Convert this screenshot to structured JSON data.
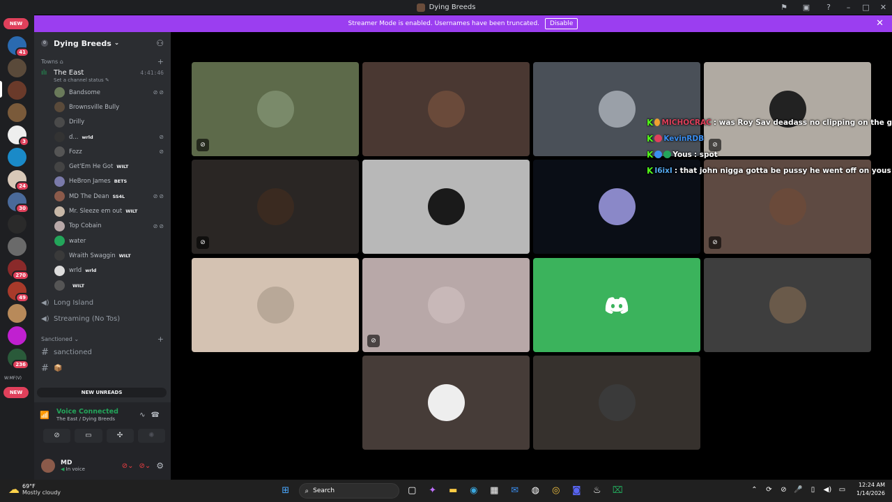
{
  "window": {
    "title": "Dying Breeds"
  },
  "banner": {
    "text": "Streamer Mode is enabled. Usernames have been truncated.",
    "button": "Disable"
  },
  "rail": {
    "badges": [
      "NEW",
      "41",
      "3",
      "24",
      "30",
      "270",
      "49",
      "236",
      "W:MF(V)",
      "NEW"
    ]
  },
  "server": {
    "name": "Dying Breeds"
  },
  "categories": {
    "towns": "Towns",
    "sanctioned": "Sanctioned"
  },
  "voice_channels": {
    "east": {
      "name": "The East",
      "timer": "4:41:46",
      "status": "Set a channel status"
    },
    "long_island": {
      "name": "Long Island"
    },
    "streaming": {
      "name": "Streaming (No Tos)"
    }
  },
  "members": [
    {
      "name": "Bandsome",
      "tag": "",
      "color": "#6a7a5a"
    },
    {
      "name": "Brownsville Bully",
      "tag": "",
      "color": "#5a4a3a"
    },
    {
      "name": "Drilly",
      "tag": "",
      "color": "#4a4a4a"
    },
    {
      "name": "d...",
      "tag": "wrld",
      "color": "#333333"
    },
    {
      "name": "Fozz",
      "tag": "",
      "color": "#555555"
    },
    {
      "name": "Get'Em He Got",
      "tag": "WILT",
      "color": "#444444"
    },
    {
      "name": "HeBron James",
      "tag": "BETS",
      "color": "#7a7aaa"
    },
    {
      "name": "MD The Dean",
      "tag": "SS4L",
      "color": "#8b5a4a"
    },
    {
      "name": "Mr. Sleeze em out",
      "tag": "WILT",
      "color": "#c8b8a8"
    },
    {
      "name": "Top Cobain",
      "tag": "",
      "color": "#b8a8a8"
    },
    {
      "name": "water",
      "tag": "",
      "color": "#23a55a"
    },
    {
      "name": "Wraith Swaggin",
      "tag": "WILT",
      "color": "#3a3a3a"
    },
    {
      "name": "wrld",
      "tag": "wrld",
      "color": "#dddddd"
    },
    {
      "name": "",
      "tag": "WILT",
      "color": "#555555"
    }
  ],
  "text_channels": {
    "sanctioned": "sanctioned",
    "box": "📦"
  },
  "new_unreads": "NEW UNREADS",
  "voice_panel": {
    "title": "Voice Connected",
    "subtitle": "The East / Dying Breeds"
  },
  "user": {
    "name": "MD",
    "status": "In voice"
  },
  "tiles": [
    {
      "bg": "#5d6a4a",
      "pfp": "#7a8a6a",
      "muted": true
    },
    {
      "bg": "#4a3832",
      "pfp": "#6a4a3a",
      "muted": false
    },
    {
      "bg": "#4a5058",
      "pfp": "#9aa0a8",
      "muted": false
    },
    {
      "bg": "#b0aaa2",
      "pfp": "#222222",
      "muted": true
    },
    {
      "bg": "#2a2624",
      "pfp": "#3a2a20",
      "muted": true
    },
    {
      "bg": "#b8b8b8",
      "pfp": "#1a1a1a",
      "muted": false
    },
    {
      "bg": "#0a0e16",
      "pfp": "#8a88c8",
      "muted": false
    },
    {
      "bg": "#5e4a42",
      "pfp": "#6a4a3a",
      "muted": true
    },
    {
      "bg": "#d4c2b2",
      "pfp": "#b8a898",
      "muted": false
    },
    {
      "bg": "#b8a8a8",
      "pfp": "#c8b8b8",
      "muted": true
    },
    {
      "bg": "#3bb35c",
      "pfp": "",
      "muted": false,
      "discord": true
    },
    {
      "bg": "#3e3e3e",
      "pfp": "#6a5a4a",
      "muted": false
    },
    {
      "bg": "#463c38",
      "pfp": "#eeeeee",
      "muted": false
    },
    {
      "bg": "#36312d",
      "pfp": "#3a3a3a",
      "muted": false
    }
  ],
  "chat": [
    {
      "name": "MICHOCRAC",
      "name_color": "#e0405b",
      "message": "was Roy Sav deadass no clipping on the g"
    },
    {
      "name": "KevinRDB",
      "name_color": "#3a8ef0",
      "message": ""
    },
    {
      "name": "Yous",
      "name_color": "#ffffff",
      "message": "spot"
    },
    {
      "name": "I6ixI",
      "name_color": "#53a8f0",
      "message": "that john nigga gotta be pussy he went off on yous fo"
    }
  ],
  "taskbar": {
    "weather_temp": "69°F",
    "weather_cond": "Mostly cloudy",
    "search": "Search",
    "time": "12:24 AM",
    "date": "1/14/2026"
  }
}
